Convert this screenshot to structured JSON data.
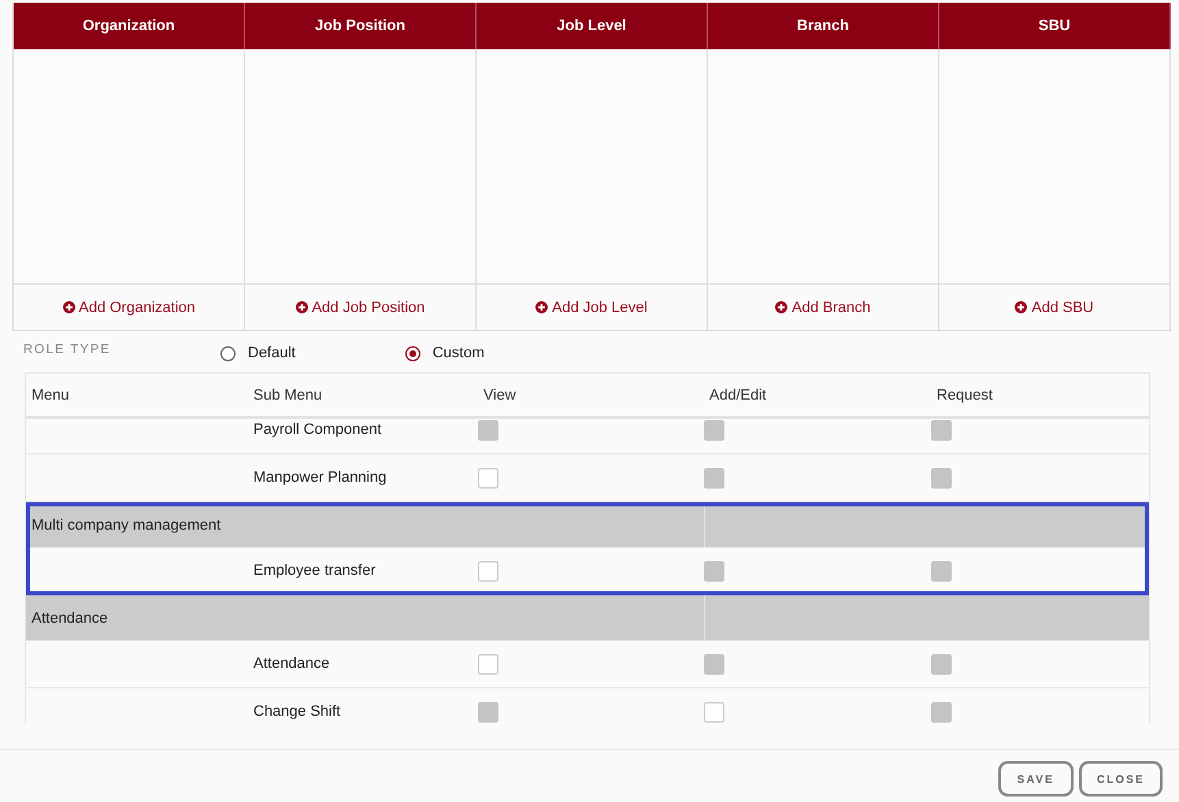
{
  "assignment_table": {
    "columns": [
      {
        "title": "Organization",
        "add_label": "Add Organization"
      },
      {
        "title": "Job Position",
        "add_label": "Add Job Position"
      },
      {
        "title": "Job Level",
        "add_label": "Add Job Level"
      },
      {
        "title": "Branch",
        "add_label": "Add Branch"
      },
      {
        "title": "SBU",
        "add_label": "Add SBU"
      }
    ]
  },
  "role_type": {
    "label": "ROLE TYPE",
    "options": [
      {
        "label": "Default",
        "selected": false
      },
      {
        "label": "Custom",
        "selected": true
      }
    ]
  },
  "permissions": {
    "columns": [
      "Menu",
      "Sub Menu",
      "View",
      "Add/Edit",
      "Request"
    ],
    "groups": [
      {
        "highlighted": false,
        "items": [
          {
            "sub_menu": "Payroll Component",
            "view_disabled": true,
            "add_edit_disabled": true,
            "request_disabled": true
          },
          {
            "sub_menu": "Manpower Planning",
            "view_disabled": false,
            "add_edit_disabled": true,
            "request_disabled": true
          }
        ]
      },
      {
        "menu": "Multi company management",
        "highlighted": true,
        "items": [
          {
            "sub_menu": "Employee transfer",
            "view_disabled": false,
            "add_edit_disabled": true,
            "request_disabled": true
          }
        ]
      },
      {
        "menu": "Attendance",
        "highlighted": false,
        "items": [
          {
            "sub_menu": "Attendance",
            "view_disabled": false,
            "add_edit_disabled": true,
            "request_disabled": true
          },
          {
            "sub_menu": "Change Shift",
            "view_disabled": true,
            "add_edit_disabled": false,
            "request_disabled": true
          }
        ]
      }
    ]
  },
  "buttons": [
    "SAVE",
    "CLOSE"
  ]
}
